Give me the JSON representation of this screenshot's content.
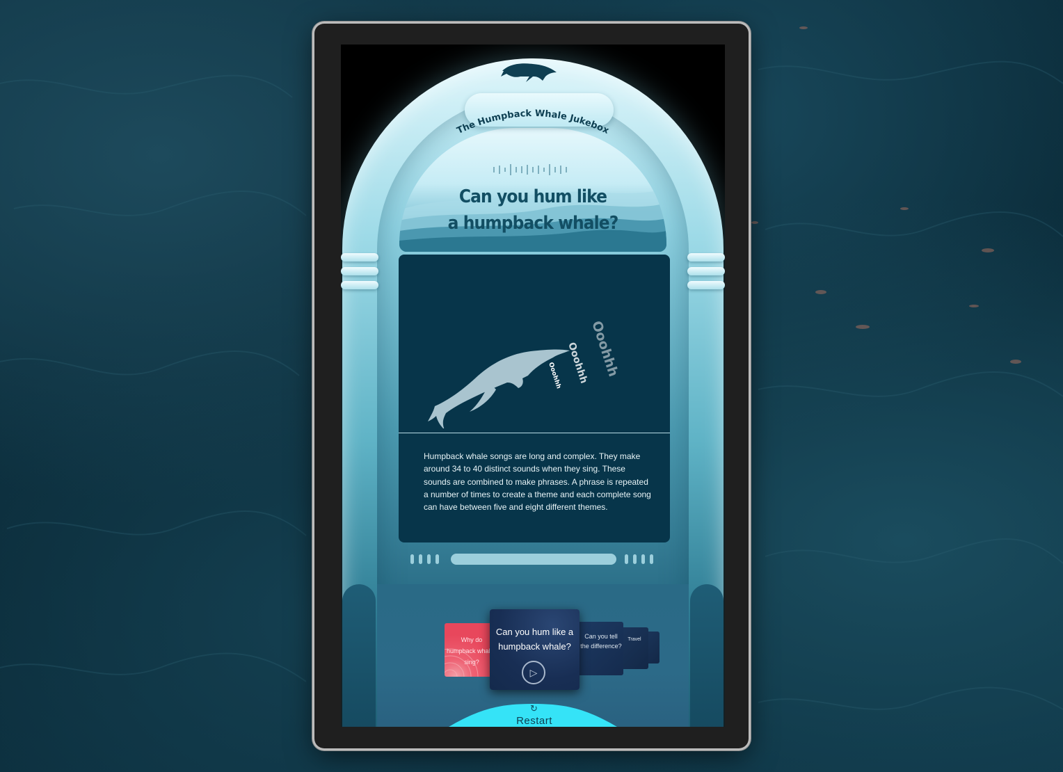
{
  "app": {
    "title": "The Humpback Whale Jukebox"
  },
  "question": {
    "line1": "Can you hum like",
    "line2": "a humpback whale?"
  },
  "illustration": {
    "sounds": [
      "Ooohhh",
      "Ooohhh",
      "Ooohhh"
    ]
  },
  "description": "Humpback whale songs are long and complex. They make around 34 to 40 distinct sounds when they sing. These sounds are combined to make phrases. A phrase is repeated a number of times to create a theme and each complete song can have between five and eight different themes.",
  "cards": [
    {
      "label": "Why do humpback whales sing?",
      "color": "#e8475c"
    },
    {
      "label": "Can you hum like a humpback whale?",
      "color": "#182e54",
      "active": true
    },
    {
      "label": "Can you tell the difference?",
      "color": "#1d3a62"
    },
    {
      "label": "Travel",
      "color": "#1b355a"
    },
    {
      "label": "",
      "color": "#1b355a"
    }
  ],
  "restart": {
    "label": "Restart",
    "icon": "refresh-icon"
  },
  "colors": {
    "panel": "#07354a",
    "accent": "#35e3f7",
    "title_text": "#124e63"
  }
}
